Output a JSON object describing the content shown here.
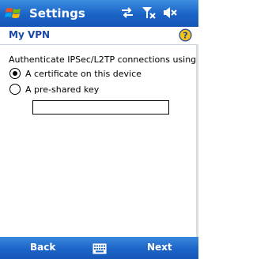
{
  "titlebar": {
    "title": "Settings",
    "start_icon": "windows-start-icon",
    "status_icons": [
      "connectivity-icon",
      "signal-off-icon",
      "volume-mute-icon"
    ]
  },
  "header": {
    "subtitle": "My VPN",
    "help_icon": "help-icon"
  },
  "content": {
    "prompt": "Authenticate IPSec/L2TP connections using:",
    "options": [
      {
        "label": "A certificate on this device",
        "checked": true
      },
      {
        "label": "A pre-shared key",
        "checked": false
      }
    ],
    "preshared_key_value": ""
  },
  "softkeys": {
    "left": "Back",
    "right": "Next",
    "center_icon": "keyboard-icon"
  },
  "colors": {
    "bar_blue": "#1a63c6",
    "title_text": "#ffffff",
    "subtitle_text": "#1a47a6"
  }
}
